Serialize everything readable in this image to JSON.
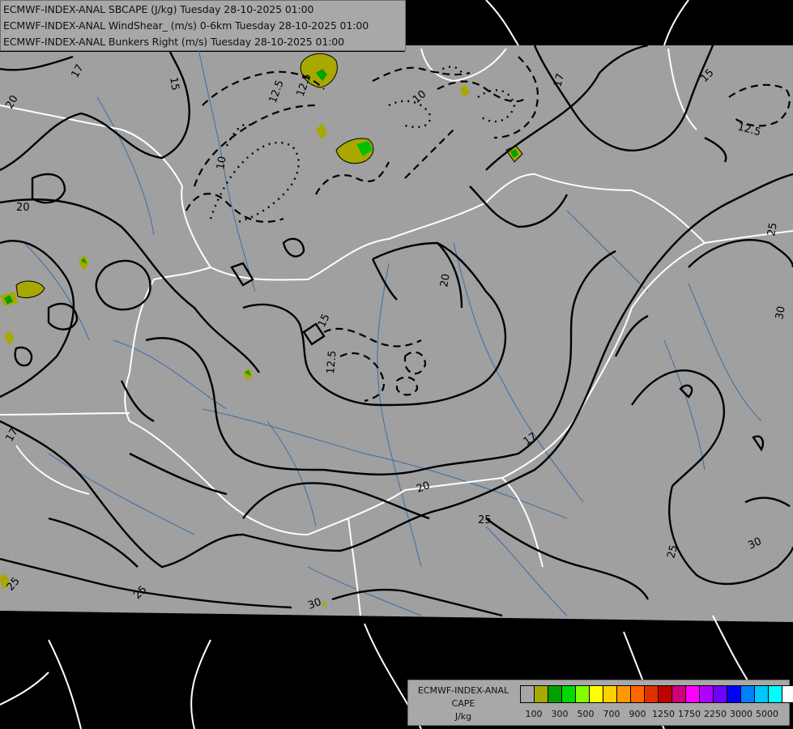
{
  "header": {
    "lines": [
      "ECMWF-INDEX-ANAL SBCAPE (J/kg) Tuesday 28-10-2025 01:00",
      "ECMWF-INDEX-ANAL WindShear_ (m/s) 0-6km Tuesday 28-10-2025 01:00",
      "ECMWF-INDEX-ANAL Bunkers Right (m/s) Tuesday 28-10-2025 01:00"
    ]
  },
  "legend": {
    "title_lines": [
      "ECMWF-INDEX-ANAL",
      "CAPE",
      "J/kg"
    ],
    "colors": [
      "#a6a6a6",
      "#a8a800",
      "#00a000",
      "#00d800",
      "#80ff00",
      "#ffff00",
      "#ffd000",
      "#ff9900",
      "#ff6600",
      "#e03000",
      "#c00000",
      "#d0007a",
      "#ff00ff",
      "#b000ff",
      "#7000ff",
      "#0000ff",
      "#0080ff",
      "#00c8ff",
      "#00ffff",
      "#ffffff"
    ],
    "ticks": [
      "100",
      "300",
      "500",
      "700",
      "900",
      "1250",
      "1750",
      "2250",
      "3000",
      "5000"
    ]
  },
  "contour_labels": {
    "solid": [
      "17",
      "15",
      "20",
      "20",
      "17",
      "15",
      "20",
      "15",
      "17",
      "20",
      "25",
      "25",
      "25",
      "30",
      "30",
      "25",
      "30",
      "17",
      "25"
    ],
    "dashed": [
      "12.5",
      "12.5",
      "10",
      "10",
      "12.5",
      "12.5"
    ]
  },
  "colors": {
    "background": "#000000",
    "data_domain": "#a0a0a0",
    "borders": "#ffffff",
    "rivers": "#3a6ea8",
    "contours": "#000000",
    "cape_low": "#a8a800",
    "cape_mid": "#00a000"
  }
}
